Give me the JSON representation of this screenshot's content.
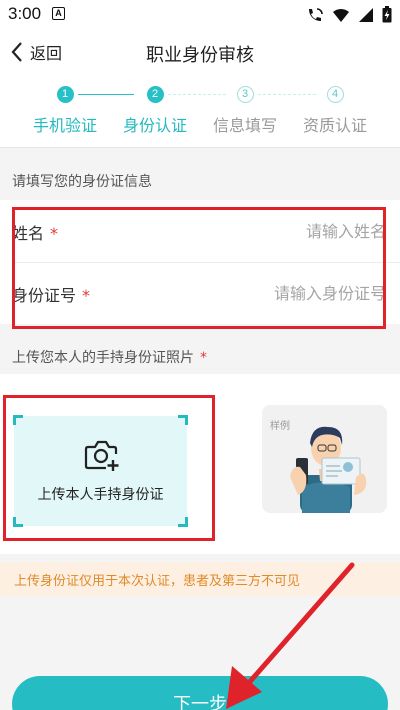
{
  "status_bar": {
    "time": "3:00",
    "notif": "A"
  },
  "header": {
    "back_label": "返回",
    "title": "职业身份审核"
  },
  "steps": [
    {
      "num": "1",
      "label": "手机验证"
    },
    {
      "num": "2",
      "label": "身份认证"
    },
    {
      "num": "3",
      "label": "信息填写"
    },
    {
      "num": "4",
      "label": "资质认证"
    }
  ],
  "id_section": {
    "title": "请填写您的身份证信息"
  },
  "form": {
    "name_label": "姓名",
    "name_placeholder": "请输入姓名",
    "id_label": "身份证号",
    "id_placeholder": "请输入身份证号",
    "required_mark": "*"
  },
  "upload_section": {
    "title": "上传您本人的手持身份证照片",
    "button_label": "上传本人手持身份证",
    "sample_tag": "样例"
  },
  "notice": "上传身份证仅用于本次认证，患者及第三方不可见",
  "next_button": "下一步",
  "colors": {
    "accent": "#26bcc3",
    "highlight_box": "#e0222a",
    "notice_text": "#e08a2a"
  }
}
